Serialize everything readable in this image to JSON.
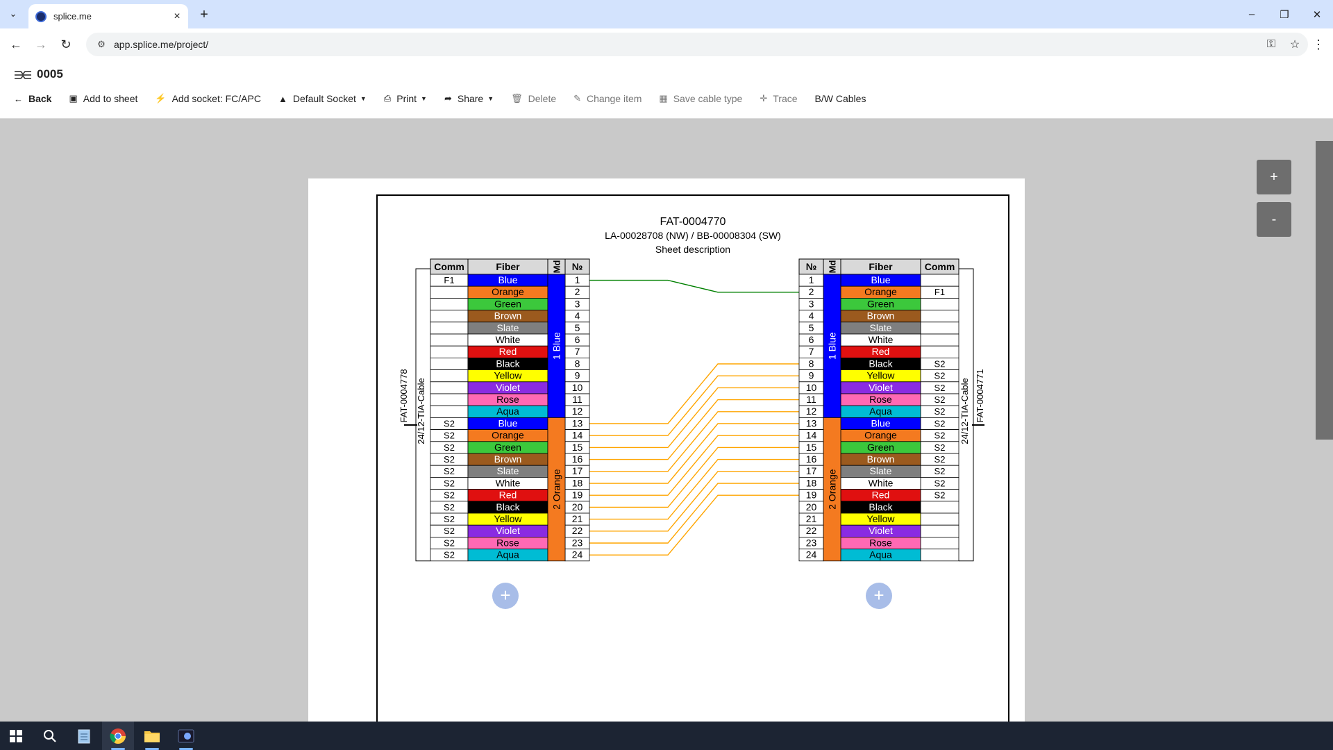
{
  "browser": {
    "tab_title": "splice.me",
    "url": "app.splice.me/project/",
    "window_controls": [
      "minimize",
      "restore",
      "close"
    ]
  },
  "app": {
    "title": "0005",
    "toolbar": {
      "back": "Back",
      "add_to_sheet": "Add to sheet",
      "add_socket": "Add socket: FC/APC",
      "default_socket": "Default Socket",
      "print": "Print",
      "share": "Share",
      "delete": "Delete",
      "change_item": "Change item",
      "save_cable_type": "Save cable type",
      "trace": "Trace",
      "bw_cables": "B/W Cables"
    },
    "zoom": {
      "in": "+",
      "out": "-"
    }
  },
  "sheet": {
    "title": "FAT-0004770",
    "subtitle": "LA-00028708 (NW) / BB-00008304 (SW)",
    "description": "Sheet description",
    "headers": {
      "comm": "Comm",
      "fiber": "Fiber",
      "module": "Md",
      "number": "№"
    },
    "left_cable": {
      "type": "24/12-TIA-Cable",
      "name": "FAT-0004778",
      "modules": [
        {
          "label": "1 Blue",
          "color": "#0000ff"
        },
        {
          "label": "2 Orange",
          "color": "#f47a20"
        }
      ],
      "comm": [
        "F1",
        "",
        "",
        "",
        "",
        "",
        "",
        "",
        "",
        "",
        "",
        "",
        "S2",
        "S2",
        "S2",
        "S2",
        "S2",
        "S2",
        "S2",
        "S2",
        "S2",
        "S2",
        "S2",
        "S2"
      ]
    },
    "right_cable": {
      "type": "24/12-TIA-Cable",
      "name": "FAT-0004771",
      "modules": [
        {
          "label": "1 Blue",
          "color": "#0000ff"
        },
        {
          "label": "2 Orange",
          "color": "#f47a20"
        }
      ],
      "comm": [
        "",
        "F1",
        "",
        "",
        "",
        "",
        "",
        "S2",
        "S2",
        "S2",
        "S2",
        "S2",
        "S2",
        "S2",
        "S2",
        "S2",
        "S2",
        "S2",
        "S2",
        "",
        "",
        "",
        "",
        ""
      ]
    },
    "fibers": [
      {
        "name": "Blue",
        "bg": "#0000ff",
        "fg": "#ffffff"
      },
      {
        "name": "Orange",
        "bg": "#f47a20",
        "fg": "#000000"
      },
      {
        "name": "Green",
        "bg": "#3cc83c",
        "fg": "#000000"
      },
      {
        "name": "Brown",
        "bg": "#9b5a1e",
        "fg": "#ffffff"
      },
      {
        "name": "Slate",
        "bg": "#7f7f7f",
        "fg": "#ffffff"
      },
      {
        "name": "White",
        "bg": "#ffffff",
        "fg": "#000000"
      },
      {
        "name": "Red",
        "bg": "#e01010",
        "fg": "#ffffff"
      },
      {
        "name": "Black",
        "bg": "#000000",
        "fg": "#ffffff"
      },
      {
        "name": "Yellow",
        "bg": "#ffff00",
        "fg": "#000000"
      },
      {
        "name": "Violet",
        "bg": "#8a2be2",
        "fg": "#ffffff"
      },
      {
        "name": "Rose",
        "bg": "#ff69b4",
        "fg": "#000000"
      },
      {
        "name": "Aqua",
        "bg": "#00bcd4",
        "fg": "#000000"
      }
    ],
    "connections": [
      {
        "from": 1,
        "to": 2,
        "color": "#008000"
      },
      {
        "from": 13,
        "to": 8,
        "color": "#ffa500"
      },
      {
        "from": 14,
        "to": 9,
        "color": "#ffa500"
      },
      {
        "from": 15,
        "to": 10,
        "color": "#ffa500"
      },
      {
        "from": 16,
        "to": 11,
        "color": "#ffa500"
      },
      {
        "from": 17,
        "to": 12,
        "color": "#ffa500"
      },
      {
        "from": 18,
        "to": 13,
        "color": "#ffa500"
      },
      {
        "from": 19,
        "to": 14,
        "color": "#ffa500"
      },
      {
        "from": 20,
        "to": 15,
        "color": "#ffa500"
      },
      {
        "from": 21,
        "to": 16,
        "color": "#ffa500"
      },
      {
        "from": 22,
        "to": 17,
        "color": "#ffa500"
      },
      {
        "from": 23,
        "to": 18,
        "color": "#ffa500"
      },
      {
        "from": 24,
        "to": 19,
        "color": "#ffa500"
      }
    ],
    "add_buttons": [
      "+",
      "+"
    ]
  },
  "taskbar": {
    "apps": [
      "start",
      "search",
      "notepad",
      "chrome",
      "file-explorer",
      "splice-app"
    ]
  }
}
